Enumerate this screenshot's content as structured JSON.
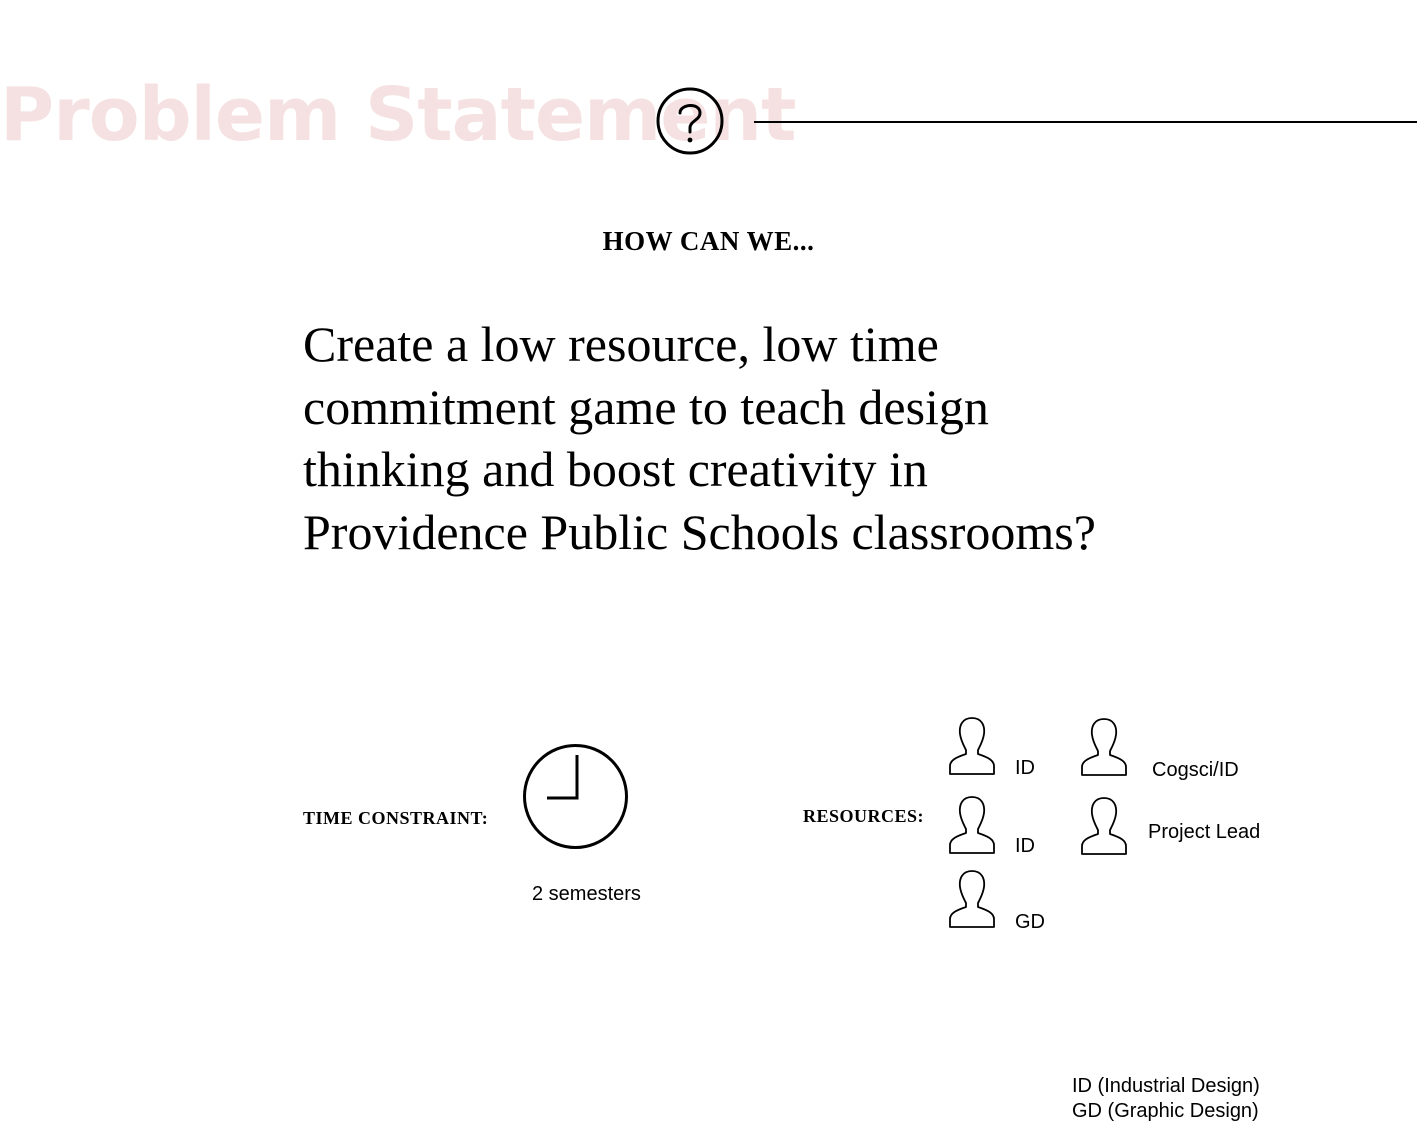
{
  "header": {
    "title": "Problem Statement",
    "title_color": "#f5e1e1",
    "icon": "question-circle-icon"
  },
  "lead": "HOW CAN WE...",
  "statement": "Create a low resource, low time commitment game to teach design thinking and boost creativity in Providence Public Schools classrooms?",
  "time": {
    "label": "TIME CONSTRAINT:",
    "icon": "clock-icon",
    "value": "2 semesters"
  },
  "resources": {
    "label": "RESOURCES:",
    "people": [
      {
        "role": "ID",
        "icon": "person-icon"
      },
      {
        "role": "ID",
        "icon": "person-icon"
      },
      {
        "role": "GD",
        "icon": "person-icon"
      },
      {
        "role": "Cogsci/ID",
        "icon": "person-icon"
      },
      {
        "role": "Project Lead",
        "icon": "person-icon"
      }
    ]
  },
  "legend": {
    "lines": [
      "ID (Industrial Design)",
      "GD (Graphic Design)"
    ]
  }
}
